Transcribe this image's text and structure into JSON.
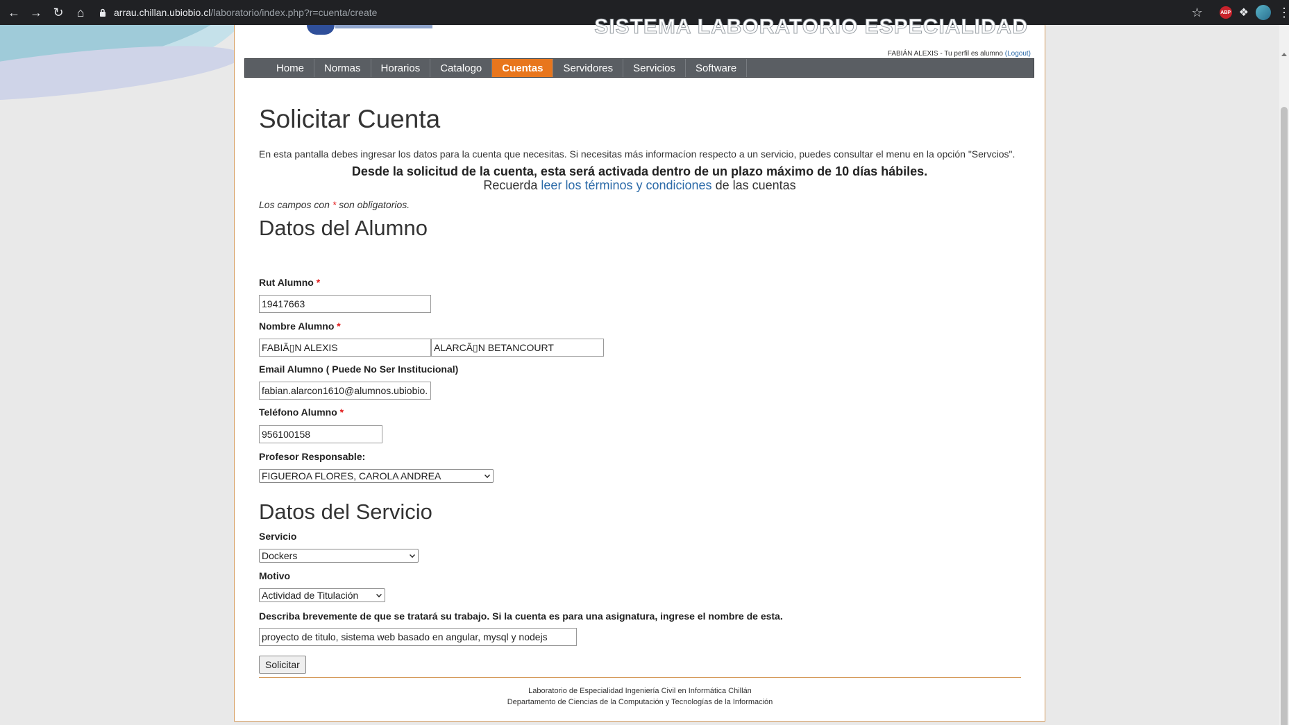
{
  "browser": {
    "url_host": "arrau.chillan.ubiobio.cl",
    "url_path": "/laboratorio/index.php?r=cuenta/create",
    "extensions": [
      "adblock-plus-icon",
      "puzzle-icon",
      "profile-avatar"
    ],
    "abp_label": "ABP"
  },
  "header": {
    "site_title": "SISTEMA LABORATORIO ESPECIALIDAD",
    "user_text": "FABIÁN ALEXIS - Tu perfil es alumno",
    "logout_label": "(Logout)"
  },
  "menu": {
    "items": [
      "Home",
      "Normas",
      "Horarios",
      "Catalogo",
      "Cuentas",
      "Servidores",
      "Servicios",
      "Software"
    ],
    "active": "Cuentas"
  },
  "page": {
    "title": "Solicitar Cuenta",
    "intro": "En esta pantalla debes ingresar los datos para la cuenta que necesitas. Si necesitas más informacíon respecto a un servicio, puedes consultar el menu en la opción \"Servcios\".",
    "notice_bold": "Desde la solicitud de la cuenta, esta será activada dentro de un plazo máximo de 10 días hábiles.",
    "notice_prefix": "Recuerda",
    "notice_link": "leer los términos y condiciones",
    "notice_suffix": "de las cuentas",
    "required_prefix": "Los campos con",
    "required_star": "*",
    "required_suffix": "son obligatorios."
  },
  "alumno": {
    "section_title": "Datos del Alumno",
    "rut_label": "Rut Alumno",
    "rut_value": "19417663",
    "nombre_label": "Nombre Alumno",
    "nombre_value": "FABIÃ▯N ALEXIS",
    "apellido_value": "ALARCÃ▯N BETANCOURT",
    "email_label": "Email Alumno ( Puede No Ser Institucional)",
    "email_value": "fabian.alarcon1610@alumnos.ubiobio.",
    "telefono_label": "Teléfono Alumno",
    "telefono_value": "956100158",
    "profesor_label": "Profesor Responsable:",
    "profesor_value": "FIGUEROA FLORES, CAROLA ANDREA"
  },
  "servicio": {
    "section_title": "Datos del Servicio",
    "servicio_label": "Servicio",
    "servicio_value": "Dockers",
    "motivo_label": "Motivo",
    "motivo_value": "Actividad de Titulación",
    "descripcion_label": "Describa brevemente de que se tratará su trabajo. Si la cuenta es para una asignatura, ingrese el nombre de esta.",
    "descripcion_value": "proyecto de titulo, sistema web basado en angular, mysql y nodejs",
    "submit_label": "Solicitar"
  },
  "footer": {
    "line1": "Laboratorio de Especialidad Ingeniería Civil en Informática Chillán",
    "line2": "Departamento de Ciencias de la Computación y Tecnologías de la Información"
  },
  "colors": {
    "menu_active": "#e8761d",
    "menu_bg": "#5a5e63",
    "link": "#2b6aa8",
    "required": "#e21b1b",
    "panel_border": "#d59a5a"
  }
}
